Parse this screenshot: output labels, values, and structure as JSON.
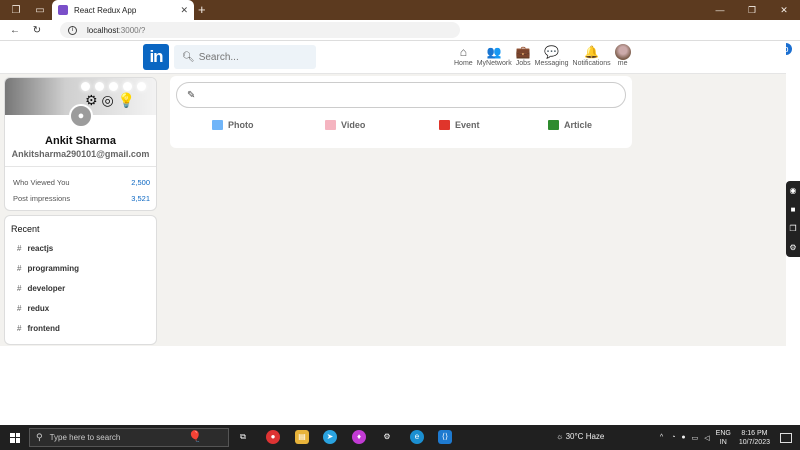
{
  "browser": {
    "tab_title": "React Redux App",
    "tab_close": "✕",
    "new_tab": "+",
    "url_host": "localhost",
    "url_rest": ":3000/?"
  },
  "header": {
    "logo_text": "in",
    "search_placeholder": "Search...",
    "nav": [
      {
        "label": "Home",
        "icon": "home-icon",
        "glyph": "⌂"
      },
      {
        "label": "MyNetwork",
        "icon": "network-icon",
        "glyph": "👥"
      },
      {
        "label": "Jobs",
        "icon": "briefcase-icon",
        "glyph": "💼"
      },
      {
        "label": "Messaging",
        "icon": "message-icon",
        "glyph": "💬"
      },
      {
        "label": "Notifications",
        "icon": "bell-icon",
        "glyph": "🔔"
      },
      {
        "label": "me",
        "icon": "avatar",
        "glyph": ""
      }
    ]
  },
  "profile": {
    "name": "Ankit Sharma",
    "email": "Ankitsharma290101@gmail.com",
    "stats": [
      {
        "label": "Who Viewed You",
        "value": "2,500"
      },
      {
        "label": "Post impressions",
        "value": "3,521"
      }
    ]
  },
  "recent": {
    "title": "Recent",
    "items": [
      "reactjs",
      "programming",
      "developer",
      "redux",
      "frontend"
    ]
  },
  "share": {
    "buttons": [
      {
        "label": "Photo",
        "color": "#70b5f9"
      },
      {
        "label": "Video",
        "color": "#f5b4c0"
      },
      {
        "label": "Event",
        "color": "#e0352b"
      },
      {
        "label": "Article",
        "color": "#2e8b2e"
      }
    ]
  },
  "taskbar": {
    "search_placeholder": "Type here to search",
    "weather_temp": "30°C",
    "weather_desc": "Haze",
    "lang_top": "ENG",
    "lang_bottom": "IN",
    "time": "8:16 PM",
    "date": "10/7/2023"
  }
}
